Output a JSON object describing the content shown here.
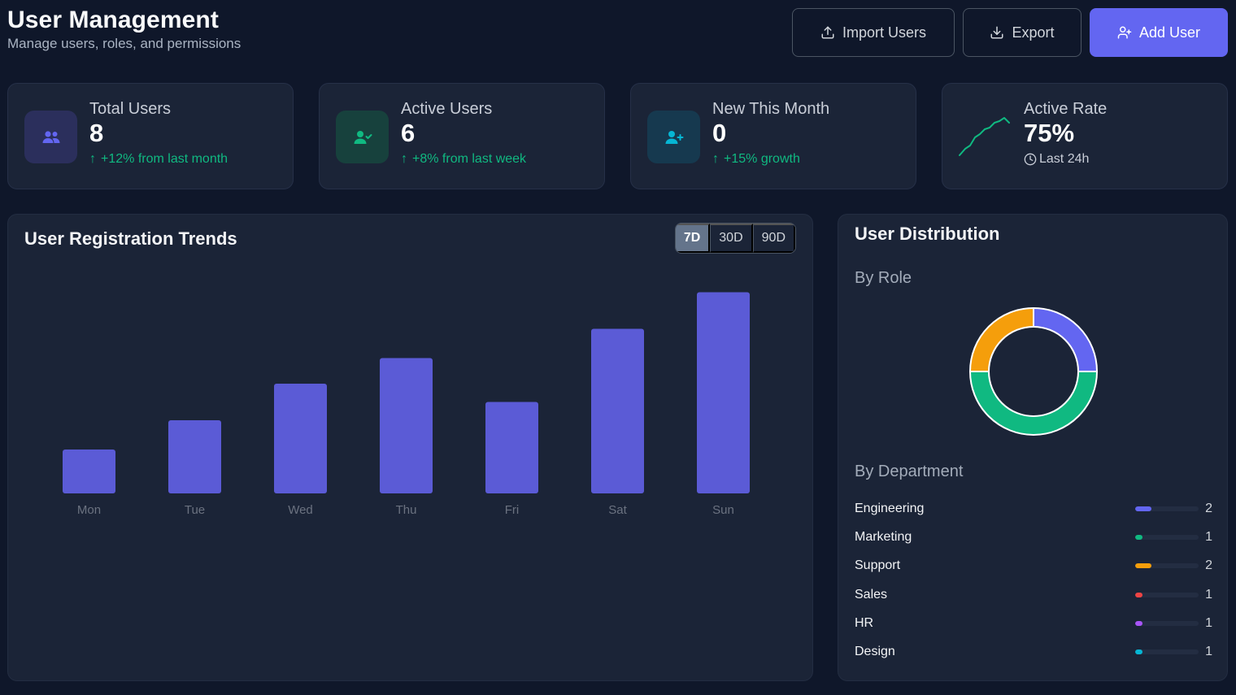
{
  "header": {
    "title": "User Management",
    "subtitle": "Manage users, roles, and permissions",
    "import_label": "Import Users",
    "export_label": "Export",
    "add_label": "Add User"
  },
  "stats": [
    {
      "label": "Total Users",
      "value": "8",
      "trend": "+12% from last month",
      "icon": "users-icon",
      "color": "#6366f1"
    },
    {
      "label": "Active Users",
      "value": "6",
      "trend": "+8% from last week",
      "icon": "user-check-icon",
      "color": "#10b981"
    },
    {
      "label": "New This Month",
      "value": "0",
      "trend": "+15% growth",
      "icon": "user-plus-icon",
      "color": "#06b6d4"
    },
    {
      "label": "Active Rate",
      "value": "75%",
      "trend": "Last 24h",
      "icon": "sparkline-icon",
      "color": "#10b981"
    }
  ],
  "trends": {
    "title": "User Registration Trends",
    "ranges": [
      "7D",
      "30D",
      "90D"
    ],
    "active_range": "7D"
  },
  "chart_data": {
    "type": "bar",
    "categories": [
      "Mon",
      "Tue",
      "Wed",
      "Thu",
      "Fri",
      "Sat",
      "Sun"
    ],
    "values": [
      12,
      20,
      30,
      37,
      25,
      45,
      55
    ],
    "ylim": [
      0,
      60
    ],
    "bar_color": "#5b5bd6",
    "grid": false
  },
  "distribution": {
    "title": "User Distribution",
    "by_role_label": "By Role",
    "by_department_label": "By Department",
    "roles": [
      {
        "value": 2,
        "color": "#6366f1"
      },
      {
        "value": 4,
        "color": "#10b981"
      },
      {
        "value": 2,
        "color": "#f59e0b"
      }
    ],
    "departments": [
      {
        "name": "Engineering",
        "count": "2",
        "color": "#6366f1",
        "fraction": 0.25
      },
      {
        "name": "Marketing",
        "count": "1",
        "color": "#10b981",
        "fraction": 0.12
      },
      {
        "name": "Support",
        "count": "2",
        "color": "#f59e0b",
        "fraction": 0.25
      },
      {
        "name": "Sales",
        "count": "1",
        "color": "#ef4444",
        "fraction": 0.12
      },
      {
        "name": "HR",
        "count": "1",
        "color": "#a855f7",
        "fraction": 0.12
      },
      {
        "name": "Design",
        "count": "1",
        "color": "#06b6d4",
        "fraction": 0.12
      }
    ]
  }
}
